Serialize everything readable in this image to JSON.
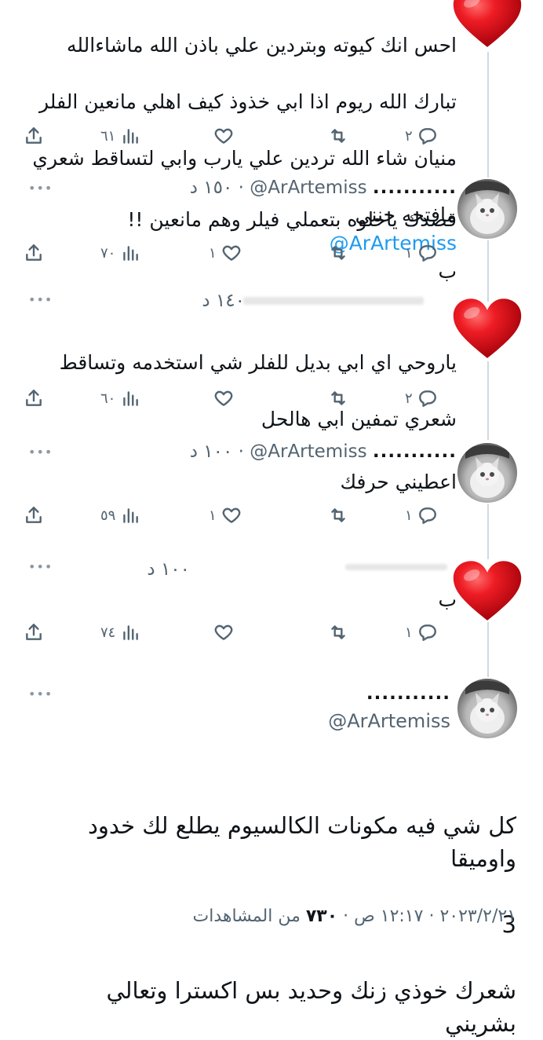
{
  "replies": [
    {
      "text_lines": [
        "احس انك كيوته وبتردين علي باذن الله ماشاءالله",
        "تبارك الله ريوم اذا ابي خذوذ كيف اهلي مانعين الفلر",
        "منيان شاء الله تردين علي يارب وابي لتساقط شعري"
      ],
      "last_line_prefix": "مافتحه جنني",
      "mention": "@ArArtemiss",
      "last_line_suffix": "ب",
      "stats": {
        "views": "٦١",
        "likes": "",
        "retweets": "",
        "replies": "٢"
      }
    },
    {
      "display_name": "...........",
      "handle": "@ArArtemiss",
      "time": "١٥٠ د",
      "text": "قصدك ياحلوه بتعملي فيلر وهم مانعين !!",
      "stats": {
        "views": "٧٠",
        "likes": "١",
        "retweets": "",
        "replies": "١"
      }
    },
    {
      "time": "١٤٠ د",
      "text_lines": [
        "ياروحي اي ابي بديل للفلر  شي استخدمه وتساقط",
        "شعري تمفين ابي هالحل"
      ],
      "stats": {
        "views": "٦٠",
        "likes": "",
        "retweets": "",
        "replies": "٢"
      }
    },
    {
      "display_name": "...........",
      "handle": "@ArArtemiss",
      "time": "١٠٠ د",
      "text": "اعطيني حرفك",
      "stats": {
        "views": "٥٩",
        "likes": "١",
        "retweets": "",
        "replies": "١"
      }
    },
    {
      "time": "١٠٠ د",
      "text": "ب",
      "stats": {
        "views": "٧٤",
        "likes": "",
        "retweets": "",
        "replies": "١"
      }
    }
  ],
  "main_tweet": {
    "display_name": "...........",
    "handle": "@ArArtemiss",
    "text_lines": [
      "كل شي فيه مكونات الكالسيوم يطلع لك خدود واوميقا",
      "3",
      "شعرك خوذي زنك وحديد بس اكسترا وتعالي بشريني"
    ],
    "time": "١٢:١٧ ص",
    "date": "٢٠٢٣/٢/٢١",
    "separator": "·",
    "views_count": "٧٣٠",
    "views_label": "من المشاهدات"
  },
  "icons": {
    "more": "more-dots-icon",
    "share": "share-icon",
    "views": "views-bar-chart-icon",
    "like": "heart-outline-icon",
    "retweet": "retweet-icon",
    "reply": "reply-bubble-icon",
    "avatar_heart": "red-heart-avatar",
    "avatar_cat": "cat-avatar"
  },
  "colors": {
    "accent": "#1d9bf0",
    "secondary_text": "#536471",
    "heart": "#e0141e",
    "thread_line": "#cfd9de"
  }
}
